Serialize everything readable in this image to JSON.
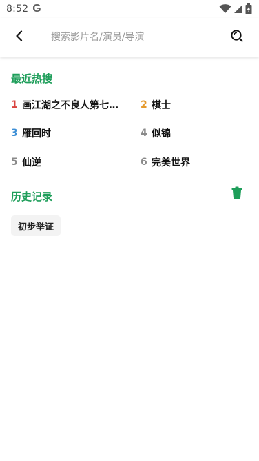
{
  "status_bar": {
    "time": "8:52",
    "google_icon_letter": "G",
    "icons": [
      "wifi-icon",
      "signal-icon",
      "battery-charging-icon"
    ]
  },
  "header": {
    "back_icon": "back-arrow-icon",
    "search_placeholder": "搜索影片名/演员/导演",
    "search_value": "",
    "search_icon": "search-icon"
  },
  "hot": {
    "title": "最近热搜",
    "items": [
      {
        "rank": "1",
        "name": "画江湖之不良人第七…",
        "rank_color": "#d9433f"
      },
      {
        "rank": "2",
        "name": "棋士",
        "rank_color": "#e59a2e"
      },
      {
        "rank": "3",
        "name": "雁回时",
        "rank_color": "#3d8fd6"
      },
      {
        "rank": "4",
        "name": "似锦",
        "rank_color": "#8a8a8a"
      },
      {
        "rank": "5",
        "name": "仙逆",
        "rank_color": "#8a8a8a"
      },
      {
        "rank": "6",
        "name": "完美世界",
        "rank_color": "#8a8a8a"
      }
    ]
  },
  "history": {
    "title": "历史记录",
    "clear_icon": "trash-icon",
    "items": [
      "初步举证"
    ]
  },
  "colors": {
    "accent": "#1e9e5a",
    "chip_bg": "#f3f3f3"
  }
}
